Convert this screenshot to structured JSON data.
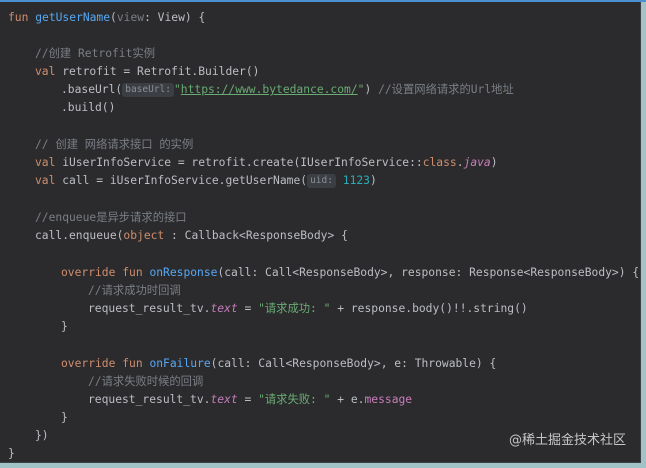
{
  "code_lines": {
    "l1_kw": "fun",
    "l1_name": "getUserName",
    "l1_open": "(",
    "l1_param": "view",
    "l1_rest": ": View) {",
    "l2_comment": "//创建 Retrofit实例",
    "l3_kw": "val",
    "l3_rest": " retrofit = Retrofit.Builder()",
    "l4_a": ".baseUrl(",
    "l4_hint": "baseUrl:",
    "l4_q1": "\"",
    "l4_url": "https://www.bytedance.com/",
    "l4_q2": "\"",
    "l4_close": ")",
    "l4_comment": "//设置网络请求的Url地址",
    "l5": ".build()",
    "l7_comment": "// 创建 网络请求接口 的实例",
    "l8_kw": "val",
    "l8_a": " iUserInfoService = retrofit.create(IUserInfoService::",
    "l8_class": "class",
    "l8_dot": ".",
    "l8_java": "java",
    "l8_close": ")",
    "l9_kw": "val",
    "l9_a": " call = iUserInfoService.getUserName(",
    "l9_hint": "uid:",
    "l9_num": "1123",
    "l9_close": ")",
    "l11_comment": "//enqueue是异步请求的接口",
    "l12_a": "call.enqueue(",
    "l12_kw": "object",
    "l12_b": " : Callback<ResponseBody> {",
    "l14_kw": "override fun",
    "l14_name": "onResponse",
    "l14_rest": "(call: Call<ResponseBody>, response: Response<ResponseBody>) {",
    "l15_comment": "//请求成功时回调",
    "l16_a": "request_result_tv.",
    "l16_prop": "text",
    "l16_b": " = ",
    "l16_str": "\"请求成功: \"",
    "l16_c": " + response.body()!!.string()",
    "l17": "}",
    "l19_kw": "override fun",
    "l19_name": "onFailure",
    "l19_rest": "(call: Call<ResponseBody>, e: Throwable) {",
    "l20_comment": "//请求失败时候的回调",
    "l21_a": "request_result_tv.",
    "l21_prop": "text",
    "l21_b": " = ",
    "l21_str": "\"请求失败: \"",
    "l21_c": " + e.",
    "l21_msg": "message",
    "l22": "}",
    "l23": "})",
    "l24": "}"
  },
  "watermark": "@稀土掘金技术社区",
  "colors": {
    "background": "#2b2b2d",
    "keyword": "#cf8e6d",
    "function": "#56a8f5",
    "string": "#6aab73",
    "comment": "#7a7e85",
    "number": "#2aacb8",
    "property": "#c77dbb"
  }
}
